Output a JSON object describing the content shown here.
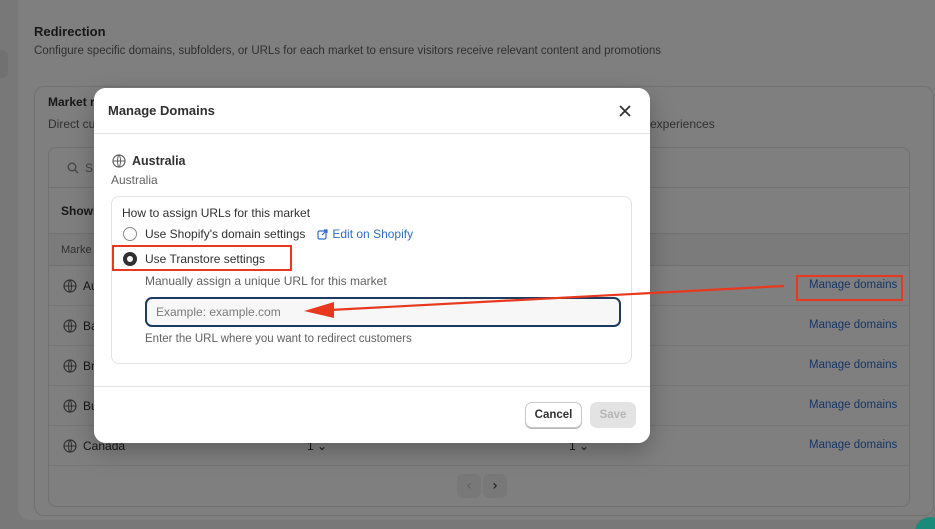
{
  "background": {
    "section_title": "Redirection",
    "section_desc": "Configure specific domains, subfolders, or URLs for each market to ensure visitors receive relevant content and promotions",
    "market_title": "Market r",
    "market_desc": "Direct cu",
    "market_desc_tail": "experiences",
    "search_placeholder": "S",
    "showing_text": "Showi",
    "column_header": "Marke",
    "rows": [
      {
        "name": "Au",
        "qty1": "",
        "qty2": "",
        "action": "Manage domains"
      },
      {
        "name": "Ba",
        "qty1": "",
        "qty2": "",
        "action": "Manage domains"
      },
      {
        "name": "Br",
        "qty1": "",
        "qty2": "",
        "action": "Manage domains"
      },
      {
        "name": "Bu",
        "qty1": "",
        "qty2": "",
        "action": "Manage domains"
      },
      {
        "name": "Canada",
        "qty1": "1 ⌄",
        "qty2": "1 ⌄",
        "action": "Manage domains"
      }
    ],
    "pager_prev": "‹",
    "pager_next": "›"
  },
  "modal": {
    "title": "Manage Domains",
    "market_name": "Australia",
    "market_sub": "Australia",
    "assign_label": "How to assign URLs for this market",
    "option_shopify": "Use Shopify's domain settings",
    "edit_link": "Edit on Shopify",
    "option_transtore": "Use Transtore settings",
    "selected_option": "transtore",
    "manual_label": "Manually assign a unique URL for this market",
    "url_input": {
      "value": "",
      "placeholder": "Example: example.com"
    },
    "url_help": "Enter the URL where you want to redirect customers",
    "cancel_label": "Cancel",
    "save_label": "Save"
  },
  "colors": {
    "annotation_red": "#e8391f",
    "link_blue": "#2c6ecb",
    "input_border": "#1f3a5f"
  }
}
